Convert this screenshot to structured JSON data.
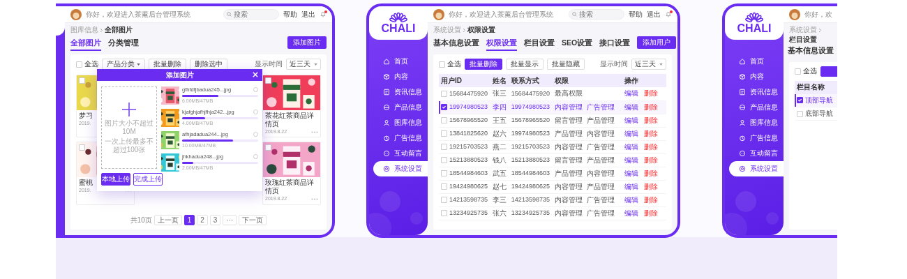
{
  "panels": [
    {
      "kind": "gallery",
      "header": {
        "greeting": "你好，欢迎进入茶薰后台管理系统",
        "search_placeholder": "搜索",
        "links": [
          "帮助",
          "退出"
        ],
        "unread": true
      },
      "breadcrumb": [
        "图库信息",
        "全部图片"
      ],
      "tabs": [
        {
          "label": "全部图片",
          "selected": true
        },
        {
          "label": "分类管理",
          "selected": false
        }
      ],
      "action_button": "添加图片",
      "toolbar": {
        "select_all": {
          "label": "全选",
          "checked": false
        },
        "buttons": [
          {
            "label": "产品分类",
            "kind": "dropdown"
          },
          {
            "label": "批量删除",
            "kind": "plain"
          },
          {
            "label": "删除选中",
            "kind": "plain"
          }
        ],
        "time_label": "显示时间",
        "time_value": "近三天"
      },
      "cards": [
        {
          "title": "梦习",
          "date": "2019.",
          "checked": false
        },
        {
          "title": "茶花红茶商品详情页",
          "date": "2019.8.22",
          "checked": false
        },
        {
          "title": "蜜桃",
          "date": "2019.",
          "checked": false
        },
        {
          "title": "玫瑰红茶商品详情页",
          "date": "2019.8.22",
          "checked": false
        }
      ],
      "modal": {
        "title": "添加图片",
        "hints": [
          "图片大小不超过10M",
          "一次上传最多不超过100张"
        ],
        "buttons": [
          {
            "label": "本地上传",
            "kind": "primary"
          },
          {
            "label": "完成上传",
            "kind": "outline"
          }
        ],
        "files": [
          {
            "name": "gfhfdfjbadua245...jpg",
            "size": "6.00MB/47MB",
            "level": 0.48,
            "selected": false
          },
          {
            "name": "kjafghjafhjfhja242...jpg",
            "size": "4.00MB/47MB",
            "level": 0.3,
            "selected": false
          },
          {
            "name": "afhjadadua244...jpg",
            "size": "10.00MB/47MB",
            "level": 0.67,
            "selected": false
          },
          {
            "name": "jhkhadua248...jpg",
            "size": "2.00MB/47MB",
            "level": 0.15,
            "selected": false
          }
        ]
      },
      "pagination": {
        "summary": "共10页",
        "prev": "上一页",
        "pages": [
          {
            "label": "1",
            "selected": true
          },
          {
            "label": "2",
            "selected": false
          },
          {
            "label": "3",
            "selected": false
          }
        ],
        "more": "···",
        "next": "下一页"
      }
    },
    {
      "kind": "users",
      "sidebar": {
        "logo": "CHALI",
        "items": [
          {
            "label": "首页",
            "selected": false
          },
          {
            "label": "内容",
            "selected": false
          },
          {
            "label": "资讯信息",
            "selected": false
          },
          {
            "label": "产品信息",
            "selected": false
          },
          {
            "label": "图库信息",
            "selected": false
          },
          {
            "label": "广告信息",
            "selected": false
          },
          {
            "label": "互动留言",
            "selected": false
          },
          {
            "label": "系统设置",
            "selected": true
          }
        ]
      },
      "header": {
        "greeting": "你好，欢迎进入茶薰后台管理系统",
        "search_placeholder": "搜索",
        "links": [
          "帮助",
          "退出"
        ],
        "unread": true
      },
      "breadcrumb": [
        "系统设置",
        "权限设置"
      ],
      "tabs": [
        {
          "label": "基本信息设置",
          "selected": false
        },
        {
          "label": "权限设置",
          "selected": true
        },
        {
          "label": "栏目设置",
          "selected": false
        },
        {
          "label": "SEO设置",
          "selected": false
        },
        {
          "label": "接口设置",
          "selected": false
        }
      ],
      "action_button": "添加用户",
      "toolbar": {
        "select_all": {
          "label": "全选",
          "checked": false
        },
        "buttons": [
          {
            "label": "批量删除",
            "kind": "primary"
          },
          {
            "label": "批量显示",
            "kind": "plain"
          },
          {
            "label": "批量隐藏",
            "kind": "plain"
          }
        ],
        "time_label": "显示时间",
        "time_value": "近三天"
      },
      "table": {
        "columns": [
          "用户ID",
          "姓名",
          "联系方式",
          "权限",
          "操作"
        ],
        "rows": [
          {
            "id": "15684475920",
            "name": "张三",
            "contact": "15684475920",
            "permissions": [
              "最高权限"
            ],
            "actions": [
              {
                "label": "编辑",
                "kind": "edit"
              },
              {
                "label": "删除",
                "kind": "delete"
              }
            ],
            "checked": false,
            "selected": false
          },
          {
            "id": "19974980523",
            "name": "李四",
            "contact": "19974980523",
            "permissions": [
              "内容管理",
              "广告管理"
            ],
            "actions": [
              {
                "label": "编辑",
                "kind": "edit"
              },
              {
                "label": "删除",
                "kind": "delete"
              }
            ],
            "checked": true,
            "selected": true
          },
          {
            "id": "15678965520",
            "name": "王五",
            "contact": "15678965520",
            "permissions": [
              "留言管理",
              "产品管理"
            ],
            "actions": [
              {
                "label": "编辑",
                "kind": "edit"
              },
              {
                "label": "删除",
                "kind": "delete"
              }
            ],
            "checked": false,
            "selected": false
          },
          {
            "id": "13841825620",
            "name": "赵六",
            "contact": "19974980523",
            "permissions": [
              "产品管理",
              "内容管理"
            ],
            "actions": [
              {
                "label": "编辑",
                "kind": "edit"
              },
              {
                "label": "删除",
                "kind": "delete"
              }
            ],
            "checked": false,
            "selected": false
          },
          {
            "id": "19215703523",
            "name": "燕二",
            "contact": "19215703523",
            "permissions": [
              "内容管理",
              "广告管理"
            ],
            "actions": [
              {
                "label": "编辑",
                "kind": "edit"
              },
              {
                "label": "删除",
                "kind": "delete"
              }
            ],
            "checked": false,
            "selected": false
          },
          {
            "id": "15213880523",
            "name": "钱八",
            "contact": "15213880523",
            "permissions": [
              "留言管理",
              "产品管理"
            ],
            "actions": [
              {
                "label": "编辑",
                "kind": "edit"
              },
              {
                "label": "删除",
                "kind": "delete"
              }
            ],
            "checked": false,
            "selected": false
          },
          {
            "id": "18544984603",
            "name": "武五",
            "contact": "18544984603",
            "permissions": [
              "产品管理",
              "内容管理"
            ],
            "actions": [
              {
                "label": "编辑",
                "kind": "edit"
              },
              {
                "label": "删除",
                "kind": "delete"
              }
            ],
            "checked": false,
            "selected": false
          },
          {
            "id": "19424980625",
            "name": "赵七",
            "contact": "19424980625",
            "permissions": [
              "内容管理",
              "产品管理"
            ],
            "actions": [
              {
                "label": "编辑",
                "kind": "edit"
              },
              {
                "label": "删除",
                "kind": "delete"
              }
            ],
            "checked": false,
            "selected": false
          },
          {
            "id": "14213598735",
            "name": "李三",
            "contact": "14213598735",
            "permissions": [
              "内容管理",
              "广告管理"
            ],
            "actions": [
              {
                "label": "编辑",
                "kind": "edit"
              },
              {
                "label": "删除",
                "kind": "delete"
              }
            ],
            "checked": false,
            "selected": false
          },
          {
            "id": "13234925735",
            "name": "张六",
            "contact": "13234925735",
            "permissions": [
              "内容管理",
              "广告管理"
            ],
            "actions": [
              {
                "label": "编辑",
                "kind": "edit"
              },
              {
                "label": "删除",
                "kind": "delete"
              }
            ],
            "checked": false,
            "selected": false
          }
        ]
      }
    },
    {
      "kind": "columns",
      "sidebar": {
        "logo": "CHALI",
        "items": [
          {
            "label": "首页",
            "selected": false
          },
          {
            "label": "内容",
            "selected": false
          },
          {
            "label": "资讯信息",
            "selected": false
          },
          {
            "label": "产品信息",
            "selected": false
          },
          {
            "label": "图库信息",
            "selected": false
          },
          {
            "label": "广告信息",
            "selected": false
          },
          {
            "label": "互动留言",
            "selected": false
          },
          {
            "label": "系统设置",
            "selected": true
          }
        ]
      },
      "header": {
        "greeting": "你好，欢"
      },
      "breadcrumb": [
        "系统设置",
        "栏目设置"
      ],
      "tabs": [
        {
          "label": "基本信息设置",
          "selected": false
        }
      ],
      "toolbar": {
        "select_all": {
          "label": "全选",
          "checked": false
        },
        "buttons": [
          {
            "kind": "primary"
          }
        ]
      },
      "table": {
        "columns": [
          "栏目名称"
        ],
        "rows": [
          {
            "name": "顶部导航",
            "checked": true,
            "selected": true
          },
          {
            "name": "底部导航",
            "checked": false,
            "selected": false
          }
        ]
      }
    }
  ]
}
